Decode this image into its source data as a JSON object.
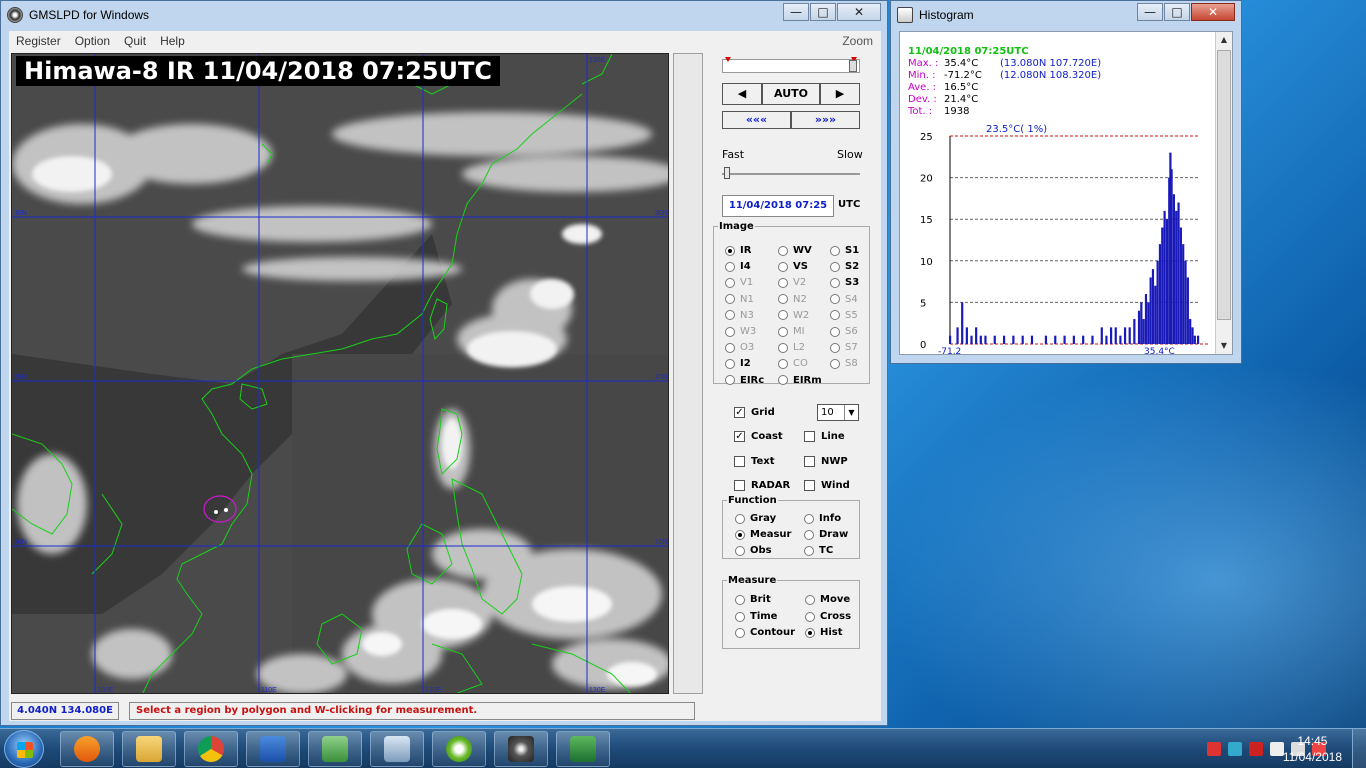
{
  "main_window": {
    "title": "GMSLPD for Windows",
    "menu": [
      "Register",
      "Option",
      "Quit",
      "Help"
    ],
    "zoom_label": "Zoom"
  },
  "image": {
    "caption": "Himawa-8 IR 11/04/2018 07:25UTC",
    "grid_labels": {
      "top": "130E",
      "lat": [
        "30N",
        "20N",
        "10N"
      ],
      "bottom": [
        "100E",
        "110E",
        "120E",
        "130E"
      ]
    }
  },
  "controls": {
    "auto_label": "AUTO",
    "prev_symbol": "◀",
    "next_symbol": "▶",
    "rewind_symbol": "«««",
    "forward_symbol": "»»»",
    "fast_label": "Fast",
    "slow_label": "Slow",
    "datetime": "11/04/2018 07:25",
    "utc_label": "UTC",
    "image_group": {
      "legend": "Image",
      "options": [
        {
          "label": "IR",
          "selected": true,
          "enabled": true
        },
        {
          "label": "WV",
          "selected": false,
          "enabled": true
        },
        {
          "label": "S1",
          "selected": false,
          "enabled": true
        },
        {
          "label": "I4",
          "selected": false,
          "enabled": true
        },
        {
          "label": "VS",
          "selected": false,
          "enabled": true
        },
        {
          "label": "S2",
          "selected": false,
          "enabled": true
        },
        {
          "label": "V1",
          "selected": false,
          "enabled": false
        },
        {
          "label": "V2",
          "selected": false,
          "enabled": false
        },
        {
          "label": "S3",
          "selected": false,
          "enabled": true
        },
        {
          "label": "N1",
          "selected": false,
          "enabled": false
        },
        {
          "label": "N2",
          "selected": false,
          "enabled": false
        },
        {
          "label": "S4",
          "selected": false,
          "enabled": false
        },
        {
          "label": "N3",
          "selected": false,
          "enabled": false
        },
        {
          "label": "W2",
          "selected": false,
          "enabled": false
        },
        {
          "label": "S5",
          "selected": false,
          "enabled": false
        },
        {
          "label": "W3",
          "selected": false,
          "enabled": false
        },
        {
          "label": "MI",
          "selected": false,
          "enabled": false
        },
        {
          "label": "S6",
          "selected": false,
          "enabled": false
        },
        {
          "label": "O3",
          "selected": false,
          "enabled": false
        },
        {
          "label": "L2",
          "selected": false,
          "enabled": false
        },
        {
          "label": "S7",
          "selected": false,
          "enabled": false
        },
        {
          "label": "I2",
          "selected": false,
          "enabled": true
        },
        {
          "label": "CO",
          "selected": false,
          "enabled": false
        },
        {
          "label": "S8",
          "selected": false,
          "enabled": false
        },
        {
          "label": "EIRc",
          "selected": false,
          "enabled": true
        },
        {
          "label": "EIRm",
          "selected": false,
          "enabled": true
        }
      ]
    },
    "overlays": [
      {
        "label": "Grid",
        "checked": true
      },
      {
        "label": "Coast",
        "checked": true
      },
      {
        "label": "Line",
        "checked": false
      },
      {
        "label": "Text",
        "checked": false
      },
      {
        "label": "NWP",
        "checked": false
      },
      {
        "label": "RADAR",
        "checked": false
      },
      {
        "label": "Wind",
        "checked": false
      }
    ],
    "grid_interval": "10",
    "function_group": {
      "legend": "Function",
      "options": [
        {
          "label": "Gray",
          "selected": false
        },
        {
          "label": "Info",
          "selected": false
        },
        {
          "label": "Measur",
          "selected": true
        },
        {
          "label": "Draw",
          "selected": false
        },
        {
          "label": "Obs",
          "selected": false
        },
        {
          "label": "TC",
          "selected": false
        }
      ]
    },
    "measure_group": {
      "legend": "Measure",
      "options": [
        {
          "label": "Brit",
          "selected": false
        },
        {
          "label": "Move",
          "selected": false
        },
        {
          "label": "Time",
          "selected": false
        },
        {
          "label": "Cross",
          "selected": false
        },
        {
          "label": "Contour",
          "selected": false
        },
        {
          "label": "Hist",
          "selected": true
        }
      ]
    }
  },
  "status": {
    "coord": "4.040N 134.080E",
    "message": "Select a region by polygon and W-clicking for measurement."
  },
  "histogram_window": {
    "title": "Histogram",
    "timestamp": "11/04/2018 07:25UTC",
    "stats": [
      {
        "key": "Max. :",
        "value": "35.4°C",
        "loc": "(13.080N 107.720E)"
      },
      {
        "key": "Min. :",
        "value": "-71.2°C",
        "loc": "(12.080N 108.320E)"
      },
      {
        "key": "Ave. :",
        "value": "16.5°C",
        "loc": ""
      },
      {
        "key": "Dev. :",
        "value": "21.4°C",
        "loc": ""
      },
      {
        "key": "Tot. :",
        "value": "1938",
        "loc": ""
      }
    ],
    "peak_label": "23.5°C( 1%)",
    "x_min_label": "-71.2",
    "x_max_label": "35.4°C"
  },
  "chart_data": {
    "type": "bar",
    "title": "",
    "xlabel": "",
    "ylabel": "",
    "x_range": [
      -71.2,
      35.4
    ],
    "ylim": [
      0,
      25
    ],
    "yticks": [
      0,
      5,
      10,
      15,
      20,
      25
    ],
    "grid": true,
    "x": [
      -71.2,
      -68,
      -66,
      -64,
      -62,
      -60,
      -58,
      -56,
      -52,
      -48,
      -44,
      -40,
      -36,
      -30,
      -26,
      -22,
      -18,
      -14,
      -10,
      -6,
      -4,
      -2,
      0,
      2,
      4,
      6,
      8,
      10,
      11,
      12,
      13,
      14,
      15,
      16,
      17,
      18,
      19,
      20,
      21,
      22,
      23,
      23.5,
      24,
      25,
      26,
      27,
      28,
      29,
      30,
      31,
      32,
      33,
      34,
      35.4
    ],
    "values": [
      1,
      2,
      5,
      2,
      1,
      2,
      1,
      1,
      1,
      1,
      1,
      1,
      1,
      1,
      1,
      1,
      1,
      1,
      1,
      2,
      1,
      2,
      2,
      1,
      2,
      2,
      3,
      4,
      5,
      3,
      6,
      5,
      8,
      9,
      7,
      10,
      12,
      14,
      16,
      15,
      20,
      23,
      21,
      18,
      16,
      17,
      14,
      12,
      10,
      8,
      3,
      2,
      1,
      1
    ]
  },
  "taskbar": {
    "time": "14:45",
    "date": "11/04/2018"
  }
}
